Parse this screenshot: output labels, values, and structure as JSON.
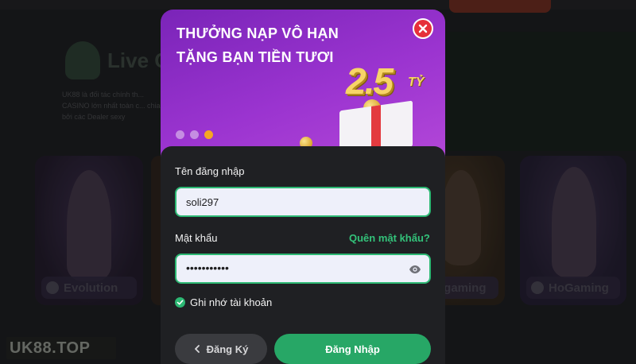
{
  "background": {
    "live_title": "Live C",
    "live_desc": "UK88 là đối tác chính th... CASINO lớn nhất toàn c... chia bởi các Dealer sexy",
    "game_cards": [
      {
        "name": "Evolution"
      },
      {
        "name": ""
      },
      {
        "name": "ogaming"
      },
      {
        "name": "HoGaming"
      }
    ],
    "brand": "UK88.TOP"
  },
  "banner": {
    "line1": "THƯỞNG NẠP VÔ HẠN",
    "line2": "TẶNG BẠN TIỀN TƯƠI",
    "prize_amount": "2.5",
    "prize_unit": "TỶ",
    "slides_total": 3,
    "active_slide": 3
  },
  "form": {
    "username_label": "Tên đăng nhập",
    "username_value": "soli297",
    "password_label": "Mật khẩu",
    "forgot_label": "Quên mật khẩu?",
    "password_masked": "•••••••••••",
    "remember_label": "Ghi nhớ tài khoản",
    "remember_checked": true,
    "register_label": "Đăng Ký",
    "login_label": "Đăng Nhập"
  },
  "colors": {
    "accent_green": "#27a766",
    "banner_purple": "#9b34d0",
    "close_red": "#e6303a"
  }
}
